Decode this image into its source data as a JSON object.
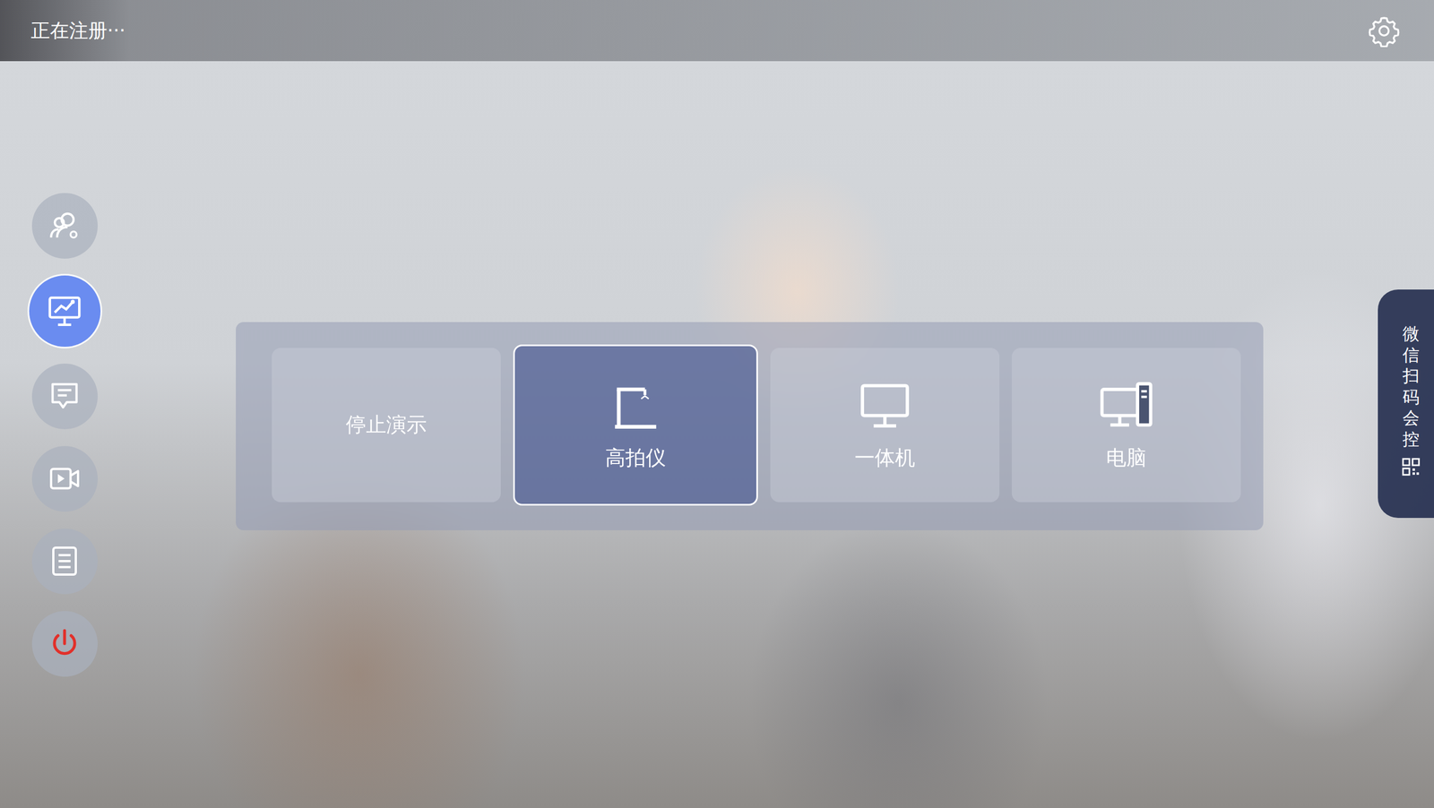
{
  "status_bar": {
    "text": "正在注册···"
  },
  "sidebar": {
    "items": [
      {
        "kind": "people",
        "selected": false
      },
      {
        "kind": "present",
        "selected": true
      },
      {
        "kind": "chat",
        "selected": false
      },
      {
        "kind": "camera",
        "selected": false
      },
      {
        "kind": "list",
        "selected": false
      },
      {
        "kind": "power",
        "selected": false
      }
    ]
  },
  "sources": [
    {
      "label": "停止演示",
      "kind": "text",
      "selected": false
    },
    {
      "label": "高拍仪",
      "kind": "document-camera",
      "selected": true
    },
    {
      "label": "一体机",
      "kind": "monitor",
      "selected": false
    },
    {
      "label": "电脑",
      "kind": "desktop",
      "selected": false
    }
  ],
  "side_tab": {
    "label": "微信扫码会控"
  }
}
